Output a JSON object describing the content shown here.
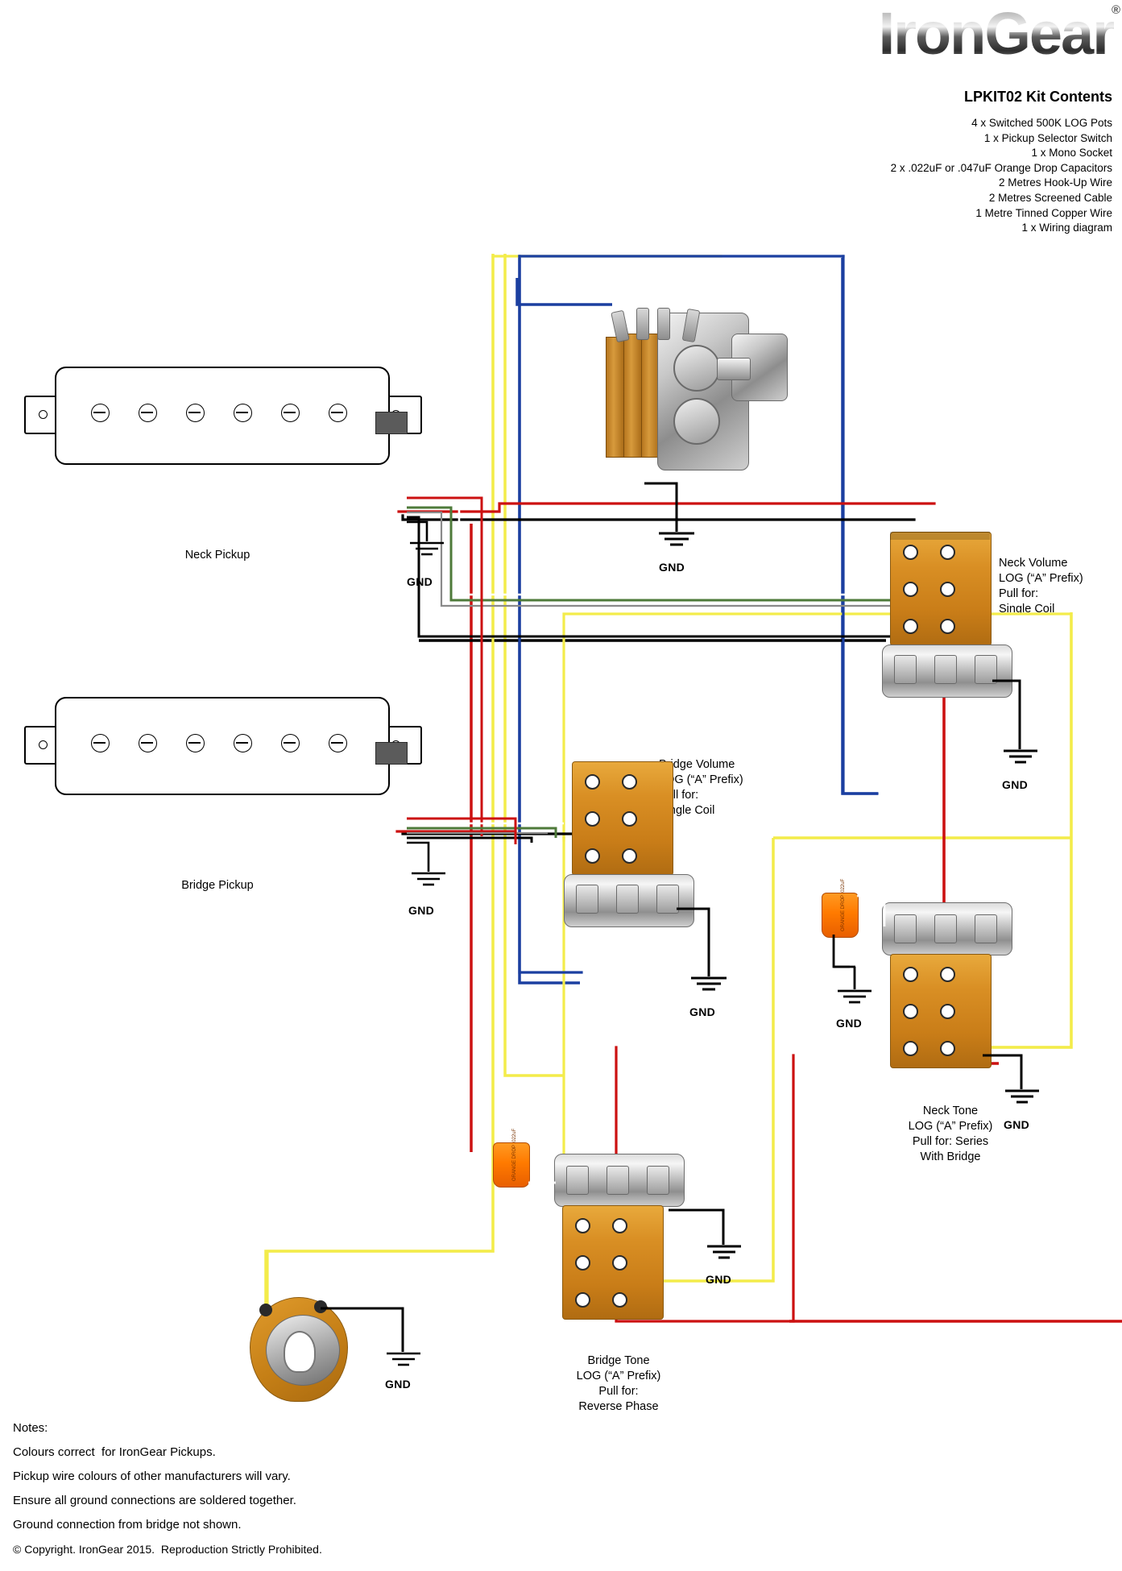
{
  "header": {
    "brand": "IronGear",
    "registered": "®",
    "kit_title": "LPKIT02 Kit Contents",
    "kit_contents": [
      "4 x Switched 500K LOG Pots",
      "1 x Pickup Selector Switch",
      "1 x Mono Socket",
      "2 x .022uF or .047uF Orange Drop Capacitors",
      "2 Metres Hook-Up Wire",
      "2 Metres Screened Cable",
      "1 Metre Tinned Copper Wire",
      "1 x Wiring diagram"
    ]
  },
  "components": {
    "neck_pickup": {
      "label": "Neck Pickup"
    },
    "bridge_pickup": {
      "label": "Bridge Pickup"
    },
    "neck_volume": {
      "label": "Neck Volume\nLOG (“A” Prefix)\nPull for:\nSingle Coil"
    },
    "bridge_volume": {
      "label": "Bridge Volume\nLOG (“A” Prefix)\nPull for:\nSingle Coil"
    },
    "neck_tone": {
      "label": "Neck Tone\nLOG (“A” Prefix)\nPull for: Series\nWith Bridge"
    },
    "bridge_tone": {
      "label": "Bridge Tone\nLOG (“A” Prefix)\nPull for:\nReverse Phase"
    },
    "cap_text": "ORANGE DROP\n.022uF"
  },
  "grounds": {
    "neck_pickup_gnd": "GND",
    "bridge_pickup_gnd": "GND",
    "switch_gnd": "GND",
    "neck_volume_gnd": "GND",
    "bridge_volume_gnd": "GND",
    "neck_tone_gnd": "GND",
    "bridge_tone_gnd": "GND",
    "socket_gnd": "GND"
  },
  "notes": {
    "heading": "Notes:",
    "lines": [
      "Colours correct  for IronGear Pickups.",
      "Pickup wire colours of other manufacturers will vary.",
      "Ensure all ground connections are soldered together.",
      "Ground connection from bridge not shown."
    ],
    "copyright": "© Copyright. IronGear 2015.  Reproduction Strictly Prohibited."
  },
  "wire_colors": {
    "blue": "#1b3fa0",
    "yellow": "#f3ec4a",
    "red": "#cc1111",
    "black": "#000000",
    "white": "#ffffff",
    "green": "#4e7a3a",
    "bare": "#8a8a8a"
  }
}
